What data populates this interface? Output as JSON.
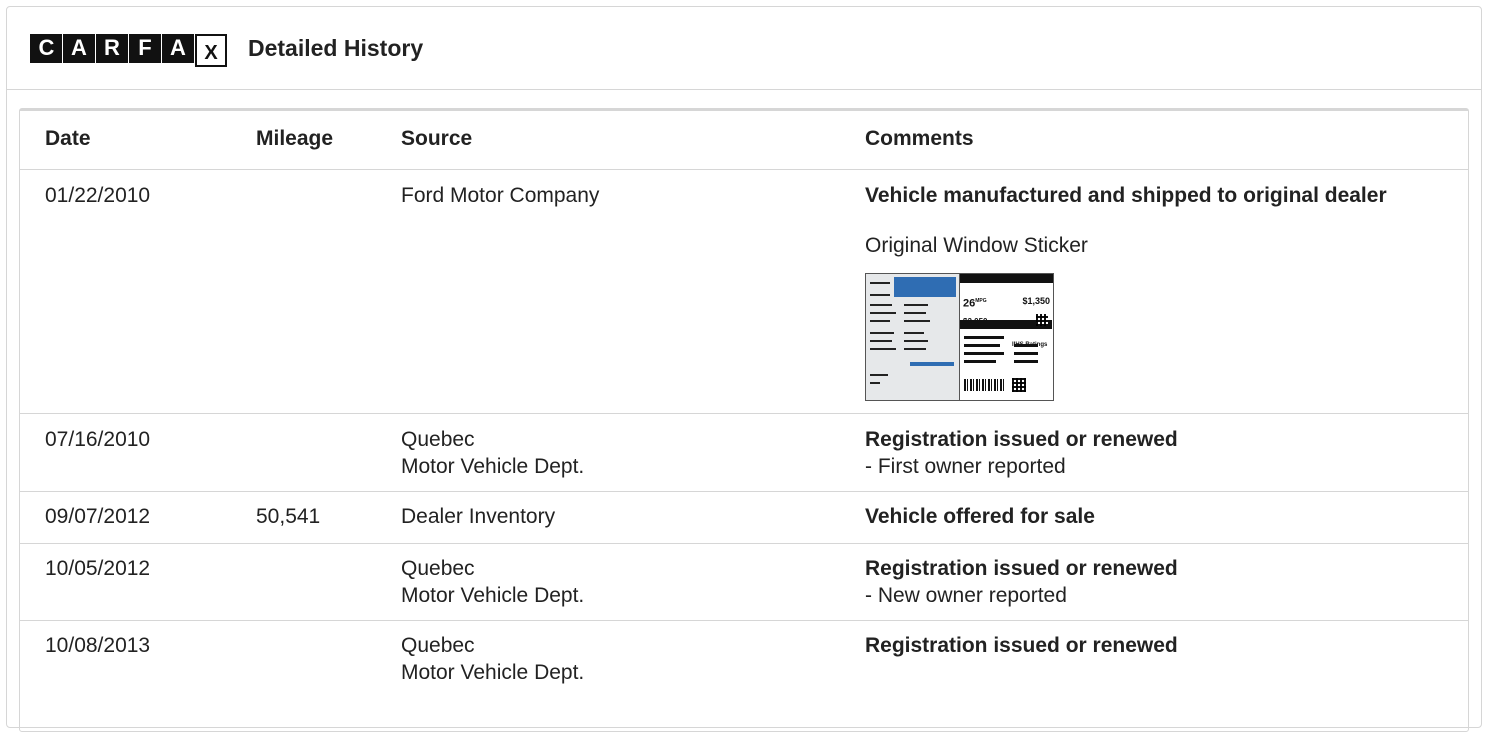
{
  "header": {
    "logo_letters": [
      "C",
      "A",
      "R",
      "F",
      "A",
      "X"
    ],
    "title": "Detailed History"
  },
  "table": {
    "columns": [
      "Date",
      "Mileage",
      "Source",
      "Comments"
    ],
    "rows": [
      {
        "date": "01/22/2010",
        "mileage": "",
        "source_line1": "Ford Motor Company",
        "source_line2": "",
        "comment_title": "Vehicle manufactured and shipped to original dealer",
        "comment_detail": "",
        "link": "Original Window Sticker",
        "sticker": {
          "mpg": "26",
          "mpg_unit": "MPG",
          "save": "$1,350",
          "cost": "$2,050",
          "ratings": "IIHS Ratings"
        }
      },
      {
        "date": "07/16/2010",
        "mileage": "",
        "source_line1": "Quebec",
        "source_line2": "Motor Vehicle Dept.",
        "comment_title": "Registration issued or renewed",
        "comment_detail": "- First owner reported"
      },
      {
        "date": "09/07/2012",
        "mileage": "50,541",
        "source_line1": "Dealer Inventory",
        "source_line2": "",
        "comment_title": "Vehicle offered for sale",
        "comment_detail": ""
      },
      {
        "date": "10/05/2012",
        "mileage": "",
        "source_line1": "Quebec",
        "source_line2": "Motor Vehicle Dept.",
        "comment_title": "Registration issued or renewed",
        "comment_detail": "- New owner reported"
      },
      {
        "date": "10/08/2013",
        "mileage": "",
        "source_line1": "Quebec",
        "source_line2": "Motor Vehicle Dept.",
        "comment_title": "Registration issued or renewed",
        "comment_detail": ""
      }
    ]
  },
  "colors": {
    "border": "#d6d6d6",
    "text": "#222222",
    "logo": "#111111",
    "sticker_blue": "#2f6db3"
  }
}
